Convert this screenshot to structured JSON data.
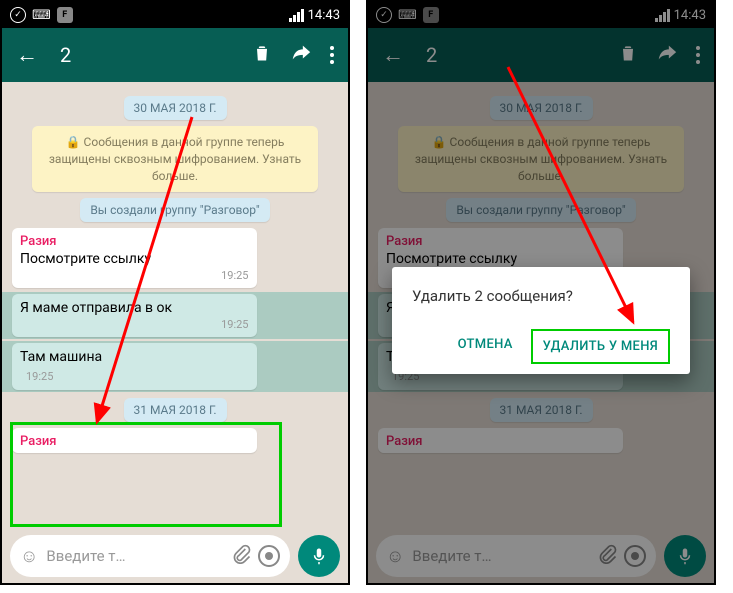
{
  "statusbar": {
    "time": "14:43"
  },
  "appbar": {
    "selectedCount": "2"
  },
  "chat": {
    "date1": "30 МАЯ 2018 Г.",
    "encryption": "🔒 Сообщения в данной группе теперь защищены сквозным шифрованием. Узнать больше.",
    "created": "Вы создали группу \"Разговор\"",
    "sender": "Разия",
    "msg1": {
      "text": "Посмотрите ссылку",
      "time": "19:25"
    },
    "msg2": {
      "text": "Я маме отправила в ок",
      "time": "19:25"
    },
    "msg3": {
      "text": "Там машина",
      "time": "19:25"
    },
    "date2": "31 МАЯ 2018 Г."
  },
  "input": {
    "placeholder": "Введите т…"
  },
  "dialog": {
    "title": "Удалить 2 сообщения?",
    "cancel": "ОТМЕНА",
    "confirm": "УДАЛИТЬ У МЕНЯ"
  }
}
